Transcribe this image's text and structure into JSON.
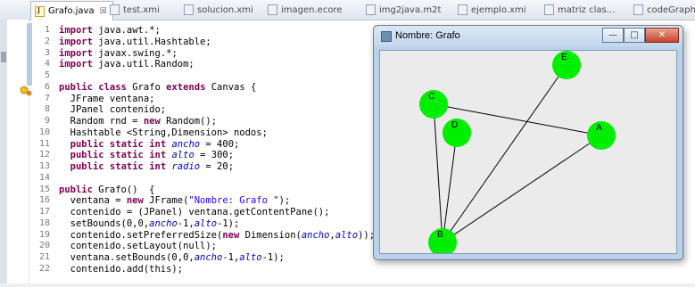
{
  "tabs": [
    {
      "label": "Grafo.java",
      "active": true,
      "icon": "java-file-icon",
      "close": "☒"
    },
    {
      "label": "test.xmi",
      "icon": "xmi-file-icon"
    },
    {
      "label": "solucion.xmi",
      "icon": "xmi-file-icon"
    },
    {
      "label": "imagen.ecore",
      "icon": "ecore-file-icon"
    },
    {
      "label": "img2java.m2t",
      "icon": "m2t-file-icon"
    },
    {
      "label": "ejemplo.xmi",
      "icon": "xmi-file-icon"
    },
    {
      "label": "matriz clas...",
      "icon": "xmi-file-icon"
    },
    {
      "label": "codeGraph",
      "icon": "file-icon"
    }
  ],
  "code_lines": [
    {
      "num": "1",
      "text": "import java.awt.*;"
    },
    {
      "num": "2",
      "text": "import java.util.Hashtable;"
    },
    {
      "num": "3",
      "text": "import javax.swing.*;"
    },
    {
      "num": "4",
      "text": "import java.util.Random;"
    },
    {
      "num": "5",
      "text": ""
    },
    {
      "num": "6",
      "text": "public class Grafo extends Canvas {"
    },
    {
      "num": "7",
      "text": "  JFrame ventana;"
    },
    {
      "num": "8",
      "text": "  JPanel contenido;"
    },
    {
      "num": "9",
      "text": "  Random rnd = new Random();"
    },
    {
      "num": "10",
      "text": "  Hashtable <String,Dimension> nodos;"
    },
    {
      "num": "11",
      "text": "  public static int ancho = 400;"
    },
    {
      "num": "12",
      "text": "  public static int alto = 300;"
    },
    {
      "num": "13",
      "text": "  public static int radio = 20;"
    },
    {
      "num": "14",
      "text": ""
    },
    {
      "num": "15",
      "text": "public Grafo()  {"
    },
    {
      "num": "16",
      "text": "  ventana = new JFrame(\"Nombre: Grafo \");"
    },
    {
      "num": "17",
      "text": "  contenido = (JPanel) ventana.getContentPane();"
    },
    {
      "num": "18",
      "text": "  setBounds(0,0,ancho-1,alto-1);"
    },
    {
      "num": "19",
      "text": "  contenido.setPreferredSize(new Dimension(ancho,alto));"
    },
    {
      "num": "20",
      "text": "  contenido.setLayout(null);"
    },
    {
      "num": "21",
      "text": "  ventana.setBounds(0,0,ancho-1,alto-1);"
    },
    {
      "num": "22",
      "text": "  contenido.add(this);"
    }
  ],
  "window": {
    "title": "Nombre: Grafo",
    "buttons": {
      "minimize": "—",
      "maximize": "□",
      "close": "✕"
    }
  },
  "graph": {
    "node_color": "#00ee00",
    "nodes": [
      {
        "id": "E",
        "label": "E"
      },
      {
        "id": "C",
        "label": "C"
      },
      {
        "id": "D",
        "label": "D"
      },
      {
        "id": "A",
        "label": "A"
      },
      {
        "id": "B",
        "label": "B"
      }
    ],
    "edges": [
      [
        "E",
        "B"
      ],
      [
        "C",
        "A"
      ],
      [
        "C",
        "B"
      ],
      [
        "D",
        "B"
      ],
      [
        "A",
        "B"
      ]
    ]
  },
  "colors": {
    "keyword": "#7f0055",
    "string": "#2a00ff",
    "field": "#0000c0"
  }
}
